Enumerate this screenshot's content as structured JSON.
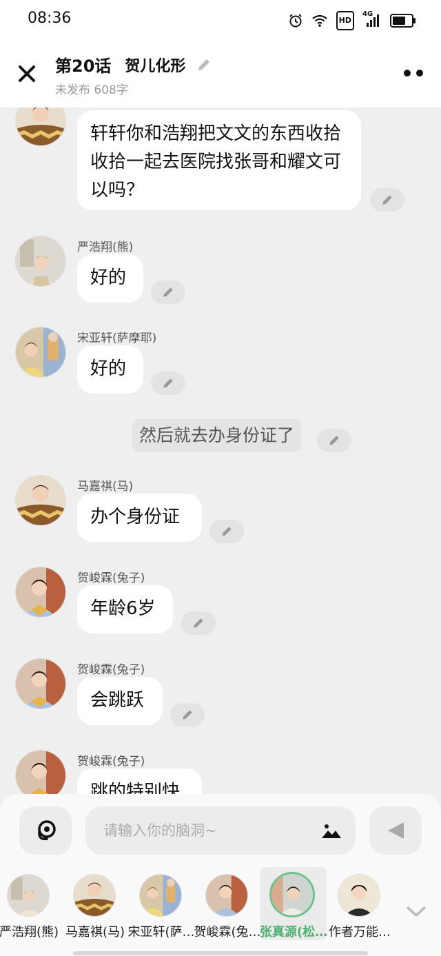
{
  "status_bar": {
    "time": "08:36",
    "icons": [
      "alarm-icon",
      "wifi-icon",
      "hd-icon",
      "signal-4g-icon",
      "battery-icon"
    ],
    "hd_label": "HD",
    "network_label": "4G"
  },
  "header": {
    "episode": "第20话",
    "chapter_title": "贺儿化形",
    "subtitle": "未发布 608字"
  },
  "messages": [
    {
      "sender": "",
      "text": "轩轩你和浩翔把文文的东西收拾收拾一起去医院找张哥和耀文可以吗？"
    },
    {
      "sender": "严浩翔(熊)",
      "text": "好的"
    },
    {
      "sender": "宋亚轩(萨摩耶)",
      "text": "好的"
    },
    {
      "narration": "然后就去办身份证了"
    },
    {
      "sender": "马嘉祺(马)",
      "text": "办个身份证"
    },
    {
      "sender": "贺峻霖(兔子)",
      "text": "年龄6岁"
    },
    {
      "sender": "贺峻霖(兔子)",
      "text": "会跳跃"
    },
    {
      "sender": "贺峻霖(兔子)",
      "text": "跳的特别快"
    }
  ],
  "input": {
    "placeholder": "请输入你的脑洞~",
    "value": ""
  },
  "roles": [
    {
      "name": "严浩翔(熊)",
      "selected": false
    },
    {
      "name": "马嘉祺(马)",
      "selected": false
    },
    {
      "name": "宋亚轩(萨…",
      "selected": false
    },
    {
      "name": "贺峻霖(兔…",
      "selected": false
    },
    {
      "name": "张真源(松…",
      "selected": true
    },
    {
      "name": "作者万能…",
      "selected": false
    }
  ],
  "colors": {
    "background": "#efefef",
    "bubble": "#ffffff",
    "selected_accent": "#4fb070",
    "secondary_text": "#999999"
  }
}
